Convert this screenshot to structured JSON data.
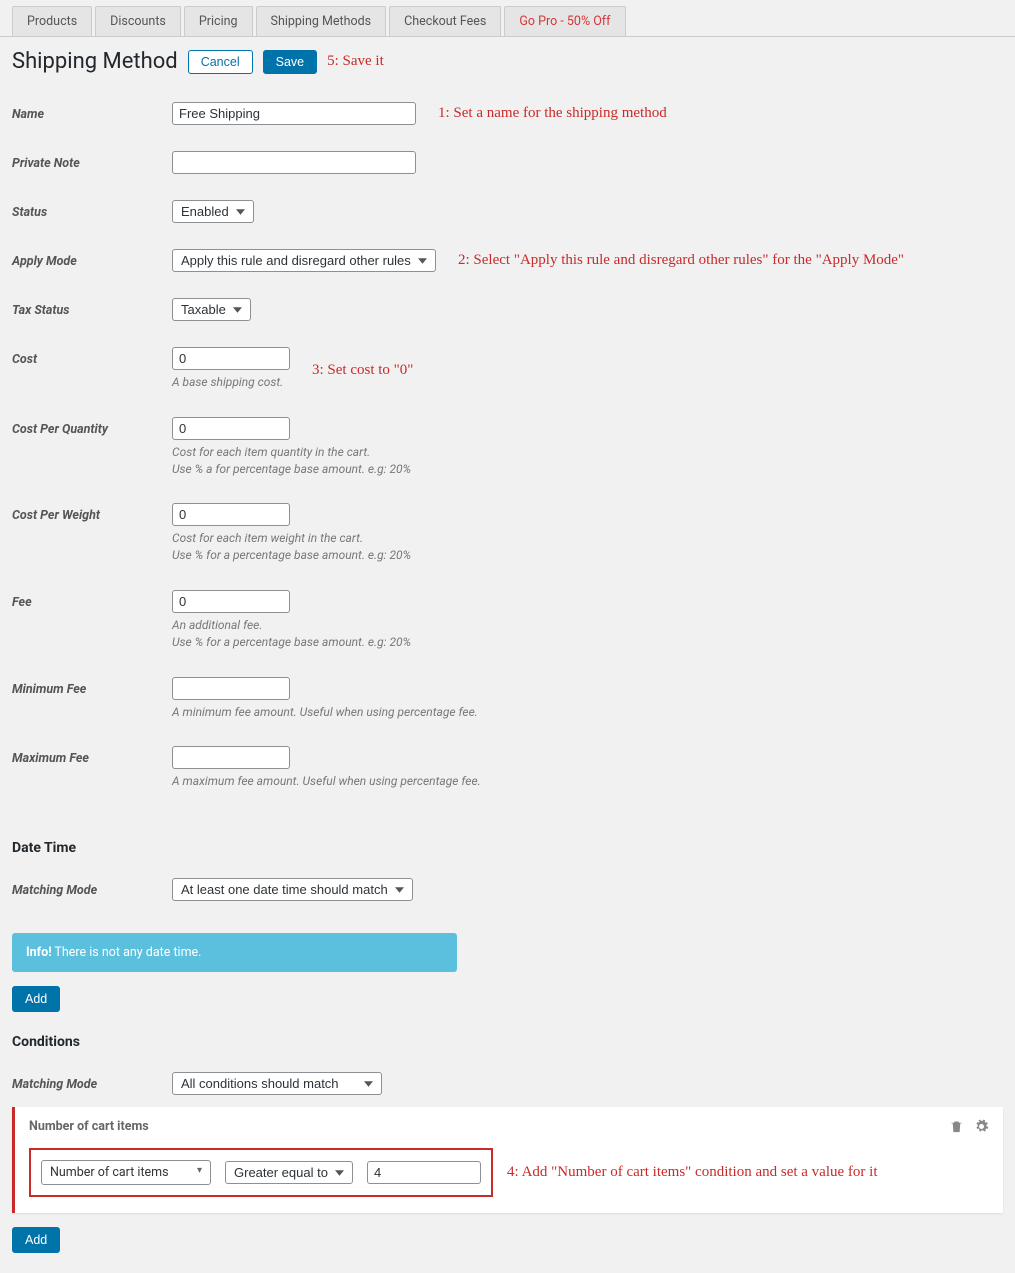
{
  "tabs": {
    "products": "Products",
    "discounts": "Discounts",
    "pricing": "Pricing",
    "shipping_methods": "Shipping Methods",
    "checkout_fees": "Checkout Fees",
    "go_pro": "Go Pro - 50% Off"
  },
  "header": {
    "title": "Shipping Method",
    "cancel": "Cancel",
    "save": "Save"
  },
  "annotations": {
    "a1": "1: Set a name for the shipping method",
    "a2": "2: Select \"Apply this rule and disregard other rules\" for the \"Apply Mode\"",
    "a3": "3: Set cost to \"0\"",
    "a4": "4: Add \"Number of cart items\" condition and set a value for it",
    "a5": "5: Save it"
  },
  "form": {
    "name_label": "Name",
    "name_value": "Free Shipping",
    "private_note_label": "Private Note",
    "private_note_value": "",
    "status_label": "Status",
    "status_value": "Enabled",
    "apply_mode_label": "Apply Mode",
    "apply_mode_value": "Apply this rule and disregard other rules",
    "tax_status_label": "Tax Status",
    "tax_status_value": "Taxable",
    "cost_label": "Cost",
    "cost_value": "0",
    "cost_help": "A base shipping cost.",
    "cpq_label": "Cost Per Quantity",
    "cpq_value": "0",
    "cpq_help1": "Cost for each item quantity in the cart.",
    "cpq_help2": "Use % a for percentage base amount. e.g: 20%",
    "cpw_label": "Cost Per Weight",
    "cpw_value": "0",
    "cpw_help1": "Cost for each item weight in the cart.",
    "cpw_help2": "Use % for a percentage base amount. e.g: 20%",
    "fee_label": "Fee",
    "fee_value": "0",
    "fee_help1": "An additional fee.",
    "fee_help2": "Use % for a percentage base amount. e.g: 20%",
    "min_fee_label": "Minimum Fee",
    "min_fee_value": "",
    "min_fee_help": "A minimum fee amount. Useful when using percentage fee.",
    "max_fee_label": "Maximum Fee",
    "max_fee_value": "",
    "max_fee_help": "A maximum fee amount. Useful when using percentage fee."
  },
  "datetime": {
    "heading": "Date Time",
    "matching_mode_label": "Matching Mode",
    "matching_mode_value": "At least one date time should match",
    "info_strong": "Info!",
    "info_text": " There is not any date time.",
    "add": "Add"
  },
  "conditions": {
    "heading": "Conditions",
    "matching_mode_label": "Matching Mode",
    "matching_mode_value": "All conditions should match",
    "card_title": "Number of cart items",
    "field_value": "Number of cart items",
    "operator_value": "Greater equal to",
    "value": "4",
    "add": "Add"
  }
}
